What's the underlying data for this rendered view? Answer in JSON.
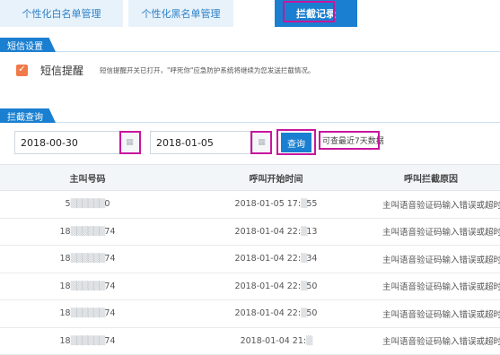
{
  "tabs": [
    {
      "label": "个性化白名单管理"
    },
    {
      "label": "个性化黑名单管理"
    },
    {
      "label": "拦截记录"
    }
  ],
  "sms_settings": {
    "title": "短信设置",
    "checkbox_label": "短信提醒",
    "checked": true,
    "note": "短信提醒开关已打开，\"呼死你\"应急防护系统将继续为您发送拦截情况。"
  },
  "query": {
    "title": "拦截查询",
    "start_date": "2018-00-30",
    "end_date": "2018-01-05",
    "button_label": "查询",
    "hint": "可查最近7天数据"
  },
  "table": {
    "headers": [
      "主叫号码",
      "呼叫开始时间",
      "呼叫拦截原因"
    ],
    "rows": [
      {
        "caller_prefix": "5",
        "caller_suffix": "0",
        "time_prefix": "2018-01-05 17:",
        "time_suffix": "55",
        "reason": "主叫语音验证码输入错误或超时"
      },
      {
        "caller_prefix": "18",
        "caller_suffix": "74",
        "time_prefix": "2018-01-04 22:",
        "time_suffix": "13",
        "reason": "主叫语音验证码输入错误或超时"
      },
      {
        "caller_prefix": "18",
        "caller_suffix": "74",
        "time_prefix": "2018-01-04 22:",
        "time_suffix": "34",
        "reason": "主叫语音验证码输入错误或超时"
      },
      {
        "caller_prefix": "18",
        "caller_suffix": "74",
        "time_prefix": "2018-01-04 22:",
        "time_suffix": "50",
        "reason": "主叫语音验证码输入错误或超时"
      },
      {
        "caller_prefix": "18",
        "caller_suffix": "74",
        "time_prefix": "2018-01-04 22:",
        "time_suffix": "50",
        "reason": "主叫语音验证码输入错误或超时"
      },
      {
        "caller_prefix": "18",
        "caller_suffix": "74",
        "time_prefix": "2018-01-04 21:",
        "time_suffix": "",
        "reason": "主叫语音验证码输入错误或超时"
      }
    ]
  }
}
